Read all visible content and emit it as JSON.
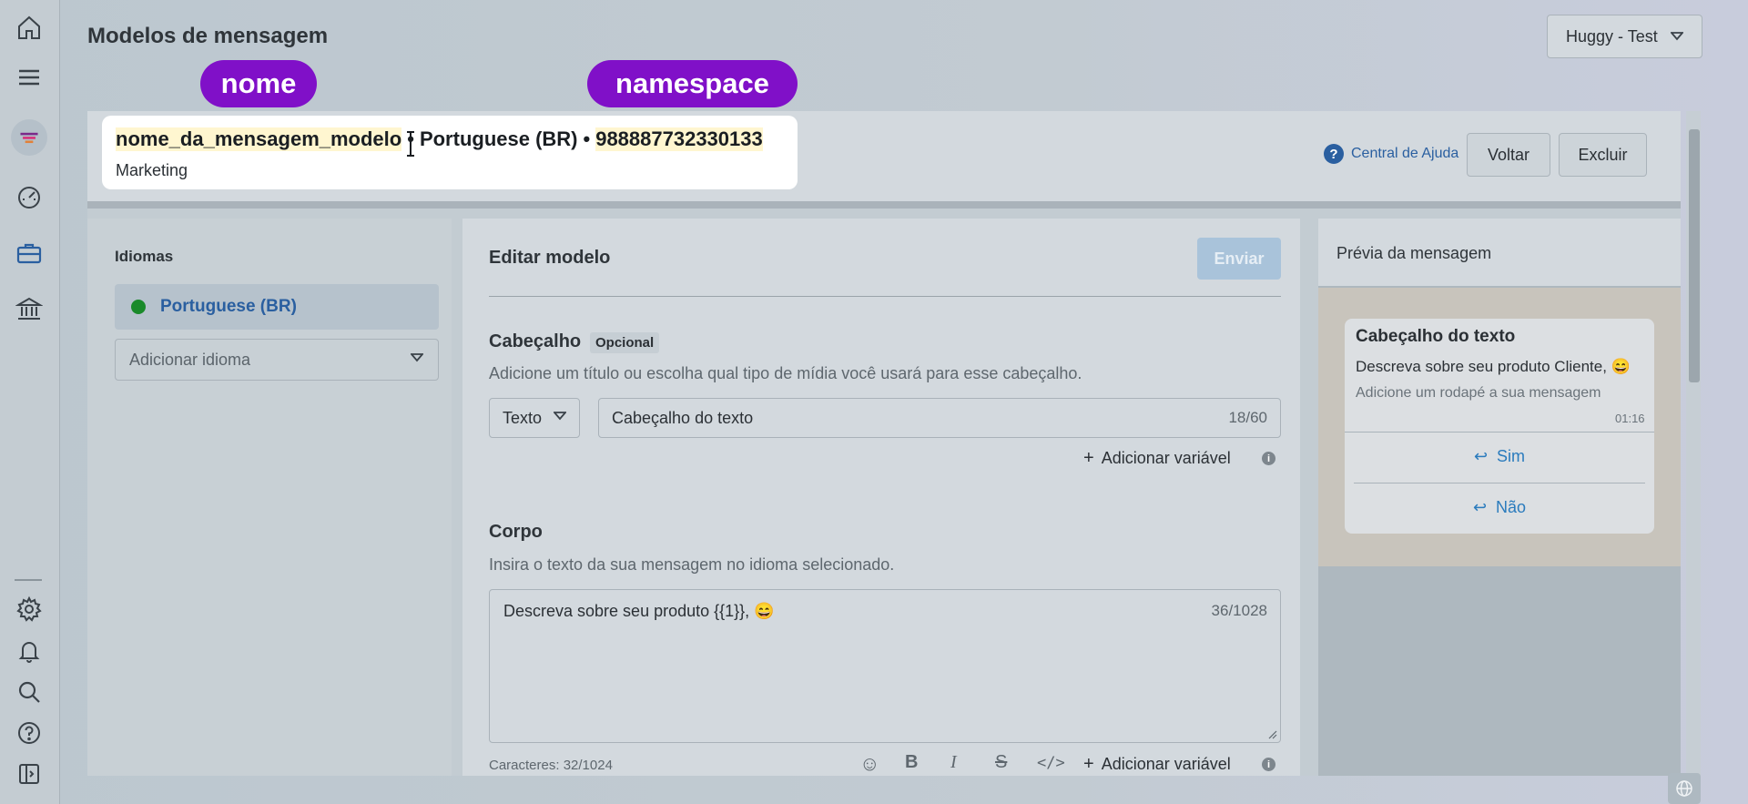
{
  "page": {
    "title": "Modelos de mensagem",
    "workspace": "Huggy - Test"
  },
  "annotations": {
    "nome": "nome",
    "namespace": "namespace"
  },
  "template": {
    "name": "nome_da_mensagem_modelo",
    "language_part": "Portuguese (BR)",
    "namespace": "988887732330133",
    "separator": "•",
    "category": "Marketing"
  },
  "header_actions": {
    "help_label": "Central de Ajuda",
    "back_label": "Voltar",
    "delete_label": "Excluir"
  },
  "languages": {
    "title": "Idiomas",
    "selected": "Portuguese (BR)",
    "add_placeholder": "Adicionar idioma"
  },
  "editor": {
    "title": "Editar modelo",
    "send_label": "Enviar",
    "header_section": {
      "title": "Cabeçalho",
      "badge": "Opcional",
      "description": "Adicione um título ou escolha qual tipo de mídia você usará para esse cabeçalho.",
      "type_value": "Texto",
      "text_value": "Cabeçalho do texto",
      "counter": "18/60",
      "add_variable": "Adicionar variável"
    },
    "body_section": {
      "title": "Corpo",
      "description": "Insira o texto da sua mensagem no idioma selecionado.",
      "text_value": "Descreva sobre seu produto {{1}}, 😄",
      "counter": "36/1028",
      "char_count": "Caracteres: 32/1024",
      "add_variable": "Adicionar variável"
    }
  },
  "preview": {
    "title": "Prévia da mensagem",
    "header": "Cabeçalho do texto",
    "body": "Descreva sobre seu produto Cliente, 😄",
    "footer": "Adicione um rodapé a sua mensagem",
    "time": "01:16",
    "buttons": [
      "Sim",
      "Não"
    ]
  },
  "icons": {
    "rail": [
      "home-icon",
      "menu-icon",
      "brand-logo",
      "dashboard-icon",
      "briefcase-icon",
      "bank-icon",
      "gear-icon",
      "bell-icon",
      "search-icon",
      "help-icon",
      "collapse-sidebar-icon"
    ],
    "toolbar": [
      "emoji-icon",
      "bold-icon",
      "italic-icon",
      "strikethrough-icon",
      "code-icon"
    ]
  },
  "colors": {
    "accent": "#2a5fa0",
    "tag_purple": "#8010c8",
    "online_green": "#1a8a2a",
    "highlight_yellow": "#fff6d0"
  }
}
